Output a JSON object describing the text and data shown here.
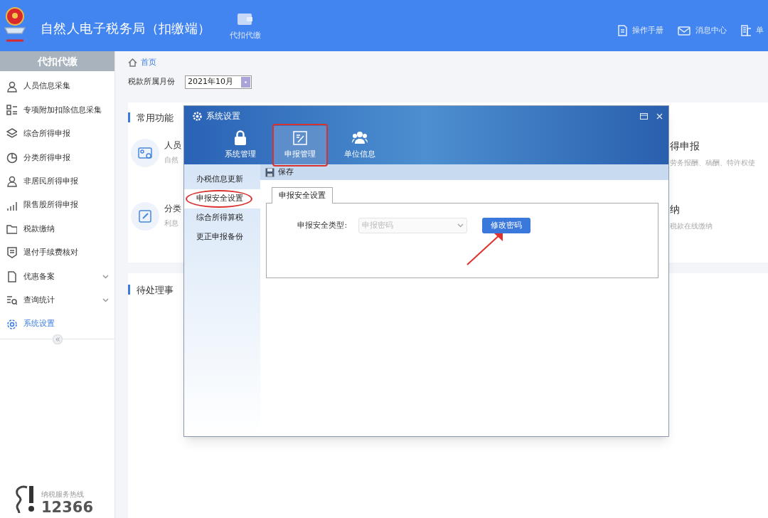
{
  "header": {
    "title": "自然人电子税务局（扣缴端）",
    "nav": [
      {
        "label": "代扣代缴"
      }
    ],
    "links": [
      {
        "label": "操作手册"
      },
      {
        "label": "消息中心"
      },
      {
        "label": "单"
      }
    ]
  },
  "sidebar": {
    "title": "代扣代缴",
    "items": [
      {
        "label": "人员信息采集",
        "selected": false,
        "expandable": false
      },
      {
        "label": "专项附加扣除信息采集",
        "selected": false,
        "expandable": false
      },
      {
        "label": "综合所得申报",
        "selected": false,
        "expandable": false
      },
      {
        "label": "分类所得申报",
        "selected": false,
        "expandable": false
      },
      {
        "label": "非居民所得申报",
        "selected": false,
        "expandable": false
      },
      {
        "label": "限售股所得申报",
        "selected": false,
        "expandable": false
      },
      {
        "label": "税款缴纳",
        "selected": false,
        "expandable": false
      },
      {
        "label": "退付手续费核对",
        "selected": false,
        "expandable": false
      },
      {
        "label": "优惠备案",
        "selected": false,
        "expandable": true
      },
      {
        "label": "查询统计",
        "selected": false,
        "expandable": true
      },
      {
        "label": "系统设置",
        "selected": true,
        "expandable": false
      }
    ],
    "hotline": {
      "caption": "纳税服务热线",
      "number": "12366"
    }
  },
  "breadcrumb": "首页",
  "month": {
    "label": "税款所属月份",
    "value": "2021年10月"
  },
  "common": {
    "title": "常用功能",
    "left": [
      {
        "title": "人员",
        "desc": "自然"
      },
      {
        "title": "分类",
        "desc": "利息"
      }
    ],
    "right": [
      {
        "title": "得申报",
        "desc": "劳务报酬、稿酬、特许权使"
      },
      {
        "title": "纳",
        "desc": "税款在线缴纳"
      }
    ]
  },
  "pending": {
    "title": "待处理事"
  },
  "dialog": {
    "title": "系统设置",
    "tabs": [
      {
        "label": "系统管理",
        "selected": false
      },
      {
        "label": "申报管理",
        "selected": true
      },
      {
        "label": "单位信息",
        "selected": false
      }
    ],
    "nav": [
      {
        "label": "办税信息更新",
        "selected": false
      },
      {
        "label": "申报安全设置",
        "selected": true
      },
      {
        "label": "综合所得算税",
        "selected": false
      },
      {
        "label": "更正申报备份",
        "selected": false
      }
    ],
    "save": "保存",
    "panel_tab": "申报安全设置",
    "field": {
      "label": "申报安全类型:",
      "placeholder": "申报密码",
      "disabled": true
    },
    "button": "修改密码"
  }
}
